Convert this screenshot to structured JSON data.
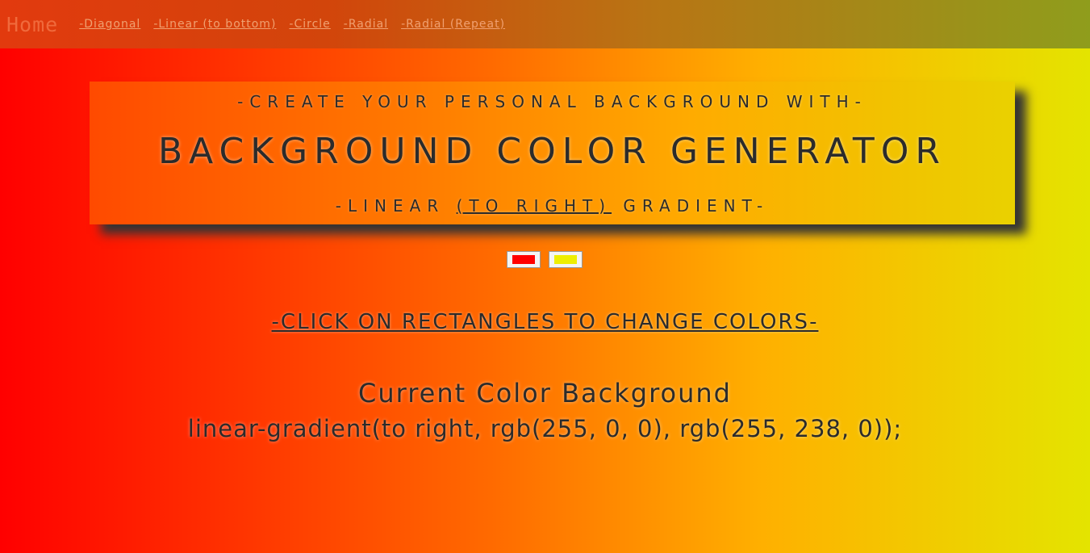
{
  "nav": {
    "home": "Home",
    "links": [
      "-Diagonal",
      "-Linear (to bottom)",
      "-Circle",
      "-Radial",
      "-Radial (Repeat)"
    ]
  },
  "header": {
    "kicker": "-CREATE YOUR PERSONAL BACKGROUND WITH-",
    "title": "BACKGROUND COLOR GENERATOR",
    "sub_prefix": "-LINEAR ",
    "sub_link": "(TO RIGHT)",
    "sub_suffix": " GRADIENT-"
  },
  "pickers": {
    "color1": "#ff0000",
    "color2": "#eeee00"
  },
  "instruction": "-CLICK ON RECTANGLES TO CHANGE COLORS-",
  "current": {
    "title": "Current Color Background",
    "value": "linear-gradient(to right, rgb(255, 0, 0), rgb(255, 238, 0));"
  },
  "colors": {
    "text": "#2b2b2b",
    "nav_text": "#f06a3c",
    "nav_link": "#f0a070"
  }
}
